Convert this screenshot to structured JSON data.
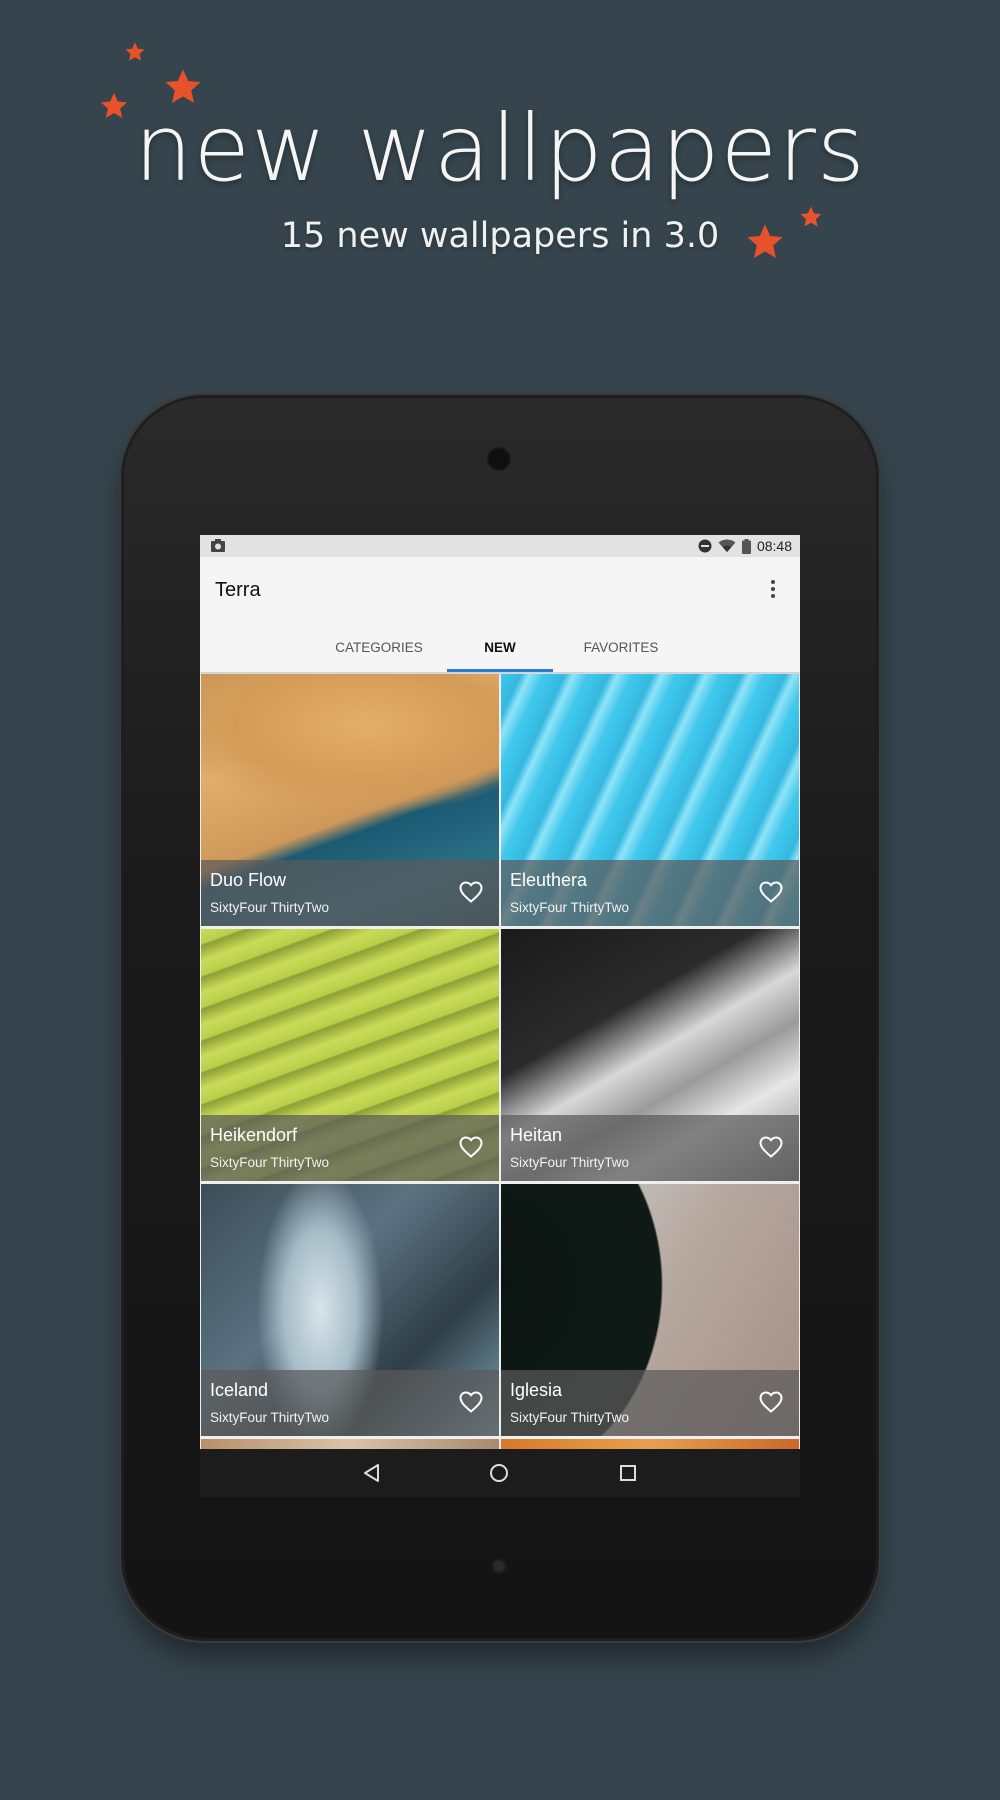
{
  "promo": {
    "title": "new wallpapers",
    "subtitle": "15 new wallpapers in 3.0",
    "accent_color": "#e8522a",
    "background_color": "#36454d"
  },
  "status_bar": {
    "time": "08:48",
    "icons": [
      "screenshot-icon",
      "dnd-icon",
      "wifi-icon",
      "battery-icon"
    ]
  },
  "app": {
    "title": "Terra",
    "menu_icon": "more-vert-icon"
  },
  "tabs": [
    {
      "label": "CATEGORIES",
      "active": false
    },
    {
      "label": "NEW",
      "active": true
    },
    {
      "label": "FAVORITES",
      "active": false
    }
  ],
  "wallpapers": [
    {
      "title": "Duo Flow",
      "author": "SixtyFour ThirtyTwo"
    },
    {
      "title": "Eleuthera",
      "author": "SixtyFour ThirtyTwo"
    },
    {
      "title": "Heikendorf",
      "author": "SixtyFour ThirtyTwo"
    },
    {
      "title": "Heitan",
      "author": "SixtyFour ThirtyTwo"
    },
    {
      "title": "Iceland",
      "author": "SixtyFour ThirtyTwo"
    },
    {
      "title": "Iglesia",
      "author": "SixtyFour ThirtyTwo"
    }
  ],
  "nav_bar": {
    "buttons": [
      "back-icon",
      "home-icon",
      "recents-icon"
    ]
  },
  "colors": {
    "tab_indicator": "#2f7ad6",
    "toolbar": "#f5f5f5",
    "nav_bar": "#1c1c1c"
  }
}
